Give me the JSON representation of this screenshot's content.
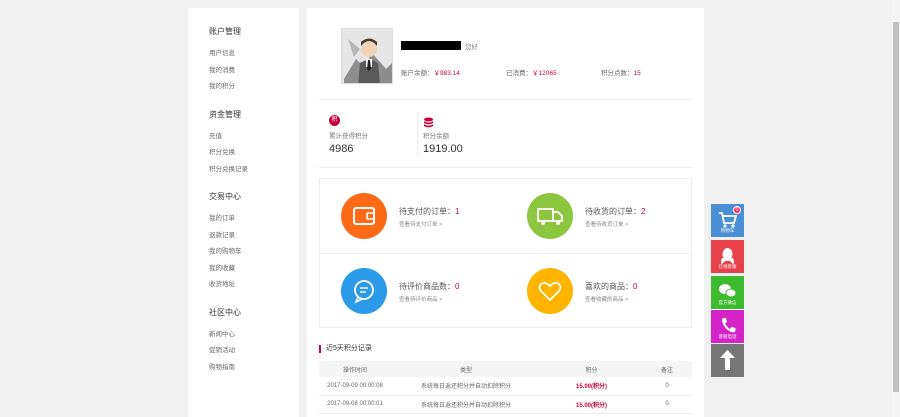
{
  "sidebar": {
    "groups": [
      {
        "title": "账户管理",
        "items": [
          "用户信息",
          "我的消费",
          "我的积分"
        ]
      },
      {
        "title": "资金管理",
        "items": [
          "充值",
          "积分兑换",
          "积分兑换记录"
        ]
      },
      {
        "title": "交易中心",
        "items": [
          "我的订单",
          "退款记录",
          "我的购物车",
          "我的收藏",
          "收货地址"
        ]
      },
      {
        "title": "社区中心",
        "items": [
          "新闻中心",
          "促销活动",
          "购物指南"
        ]
      }
    ]
  },
  "profile": {
    "greeting": "您好",
    "balance_label": "账户余额：",
    "balance_value": "￥983.14",
    "spent_label": "已消费：",
    "spent_value": "￥12065",
    "points_label": "积分点数：",
    "points_value": "15"
  },
  "points": {
    "earned_label": "累计获得积分",
    "earned_value": "4986",
    "balance_label": "积分余额",
    "balance_value": "1919.00"
  },
  "orders": [
    {
      "title": "待支付的订单：",
      "count": "1",
      "link": "查看待支付订单 >",
      "color": "#ff6a16"
    },
    {
      "title": "待收货的订单：",
      "count": "2",
      "link": "查看待收货订单 >",
      "color": "#8cc63f"
    },
    {
      "title": "待评价商品数：",
      "count": "0",
      "link": "查看待评价商品 >",
      "color": "#2b9ae8"
    },
    {
      "title": "喜欢的商品：",
      "count": "0",
      "link": "查看收藏的商品 >",
      "color": "#ffb400"
    }
  ],
  "log": {
    "title": "近5天积分记录",
    "columns": [
      "操作时间",
      "类型",
      "积分",
      "备注"
    ],
    "rows": [
      {
        "time": "2017-09-09 00:00:08",
        "type": "系统每日返还积分并自动扣除积分",
        "points": "15.00(积分)",
        "note": "0"
      },
      {
        "time": "2017-09-08 00:00:01",
        "type": "系统每日返还积分并自动扣除积分",
        "points": "15.00(积分)",
        "note": "0"
      }
    ]
  },
  "toolbar": {
    "cart_label": "购物车",
    "cart_badge": "0",
    "qq_label": "在线客服",
    "wechat_label": "官方微信",
    "phone_label": "客服电话"
  },
  "colors": {
    "accent": "#c7003c",
    "cart_bg": "#4a8fd6",
    "qq_bg": "#e8414a",
    "wechat_bg": "#3dbb2f",
    "phone_bg": "#d423c8",
    "top_bg": "#777777"
  }
}
